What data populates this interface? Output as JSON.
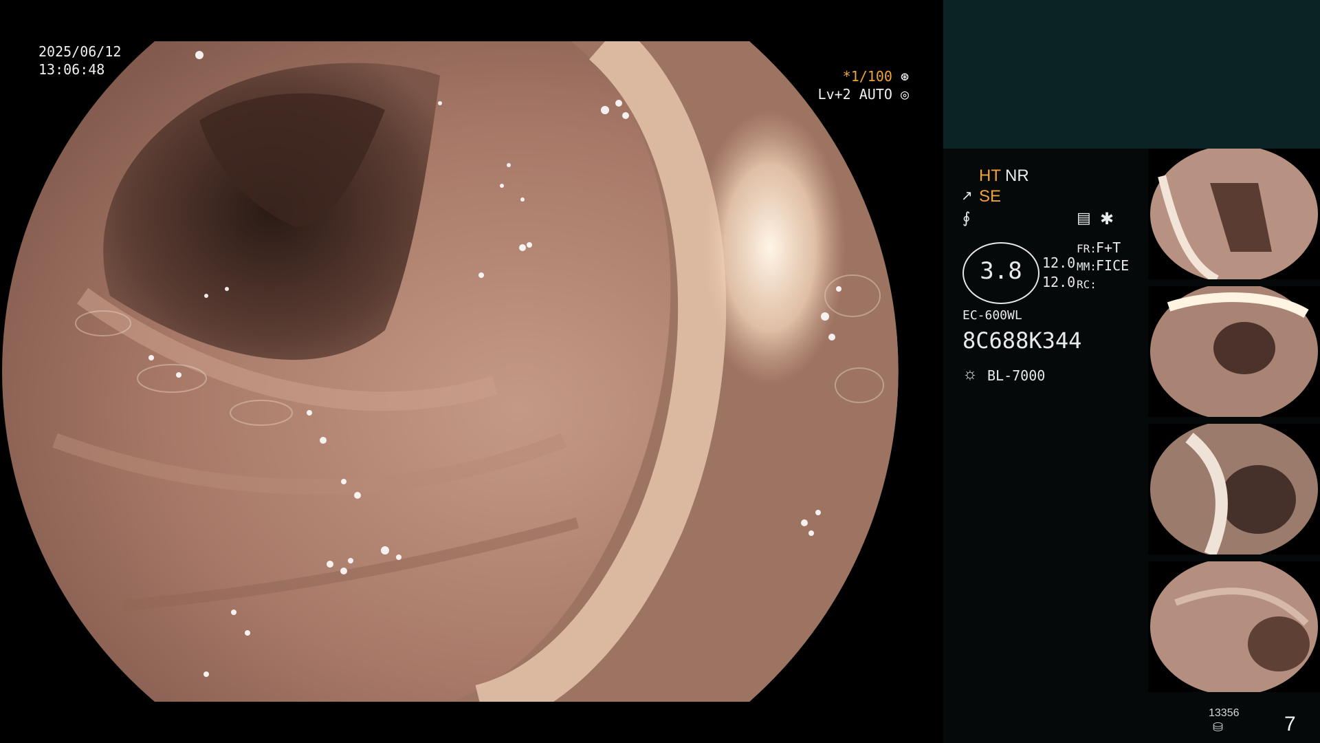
{
  "overlay": {
    "date": "2025/06/12",
    "time": "13:06:48",
    "shutter": "*1/100",
    "level": "Lv+2 AUTO"
  },
  "panel": {
    "mode_ht": "HT",
    "mode_nr": "NR",
    "mode_se": "SE",
    "magnification": "3.8",
    "value_top": "12.0",
    "value_bottom": "12.0",
    "fr_label": "FR:",
    "fr_value": "F+T",
    "mm_label": "MM:",
    "mm_value": "FICE",
    "rc_label": "RC:",
    "scope_model": "EC-600WL",
    "serial": "8C688K344",
    "light_source": "BL-7000",
    "image_count": "13356",
    "page_number": "7"
  },
  "colors": {
    "accent_orange": "#f0a33a",
    "panel_top": "#0b2323",
    "panel_bg": "#050909"
  },
  "icons": [
    "shutter-gear-icon",
    "auto-iris-icon",
    "structure-enhance-icon",
    "frequency-icon",
    "list-icon",
    "asterisk-icon",
    "light-bulb-icon",
    "storage-icon"
  ]
}
